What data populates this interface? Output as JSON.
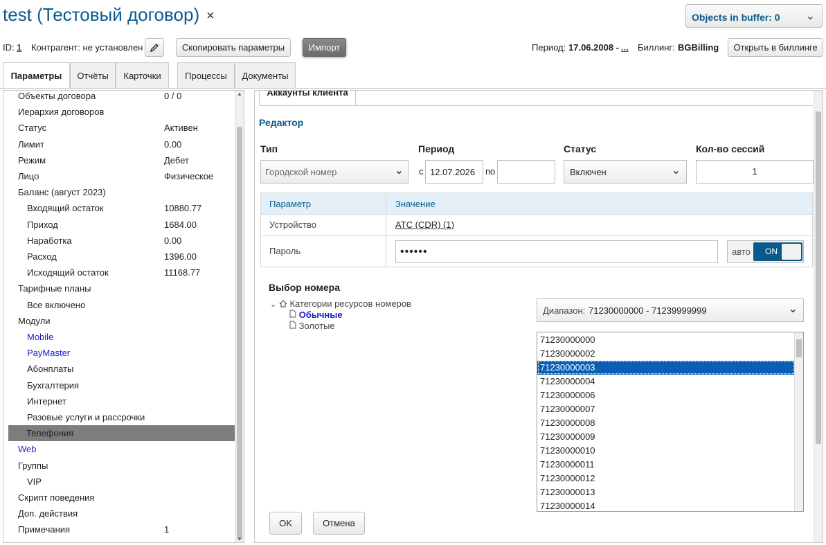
{
  "header": {
    "title": "test (Тестовый договор)",
    "close_icon": "×",
    "buffer_label": "Objects in buffer: 0",
    "id_label": "ID:",
    "id_value": "1",
    "contragent": "Контрагент: не установлен",
    "copy_params": "Скопировать параметры",
    "import": "Импорт",
    "period_label": "Период:",
    "period_value": "17.06.2008 -",
    "period_link": "...",
    "billing_label": "Биллинг:",
    "billing_value": "BGBilling",
    "open_billing": "Открыть в биллинге"
  },
  "tabs": [
    "Параметры",
    "Отчёты",
    "Карточки",
    "Процессы",
    "Документы"
  ],
  "left": {
    "rows": [
      {
        "label": "Объекты договора",
        "value": "0 / 0",
        "indent": 0
      },
      {
        "label": "Иерархия договоров",
        "value": "",
        "indent": 0
      },
      {
        "label": "Статус",
        "value": "Активен",
        "indent": 0
      },
      {
        "label": "Лимит",
        "value": "0.00",
        "indent": 0
      },
      {
        "label": "Режим",
        "value": "Дебет",
        "indent": 0
      },
      {
        "label": "Лицо",
        "value": "Физическое",
        "indent": 0
      },
      {
        "label": "Баланс (август 2023)",
        "value": "",
        "indent": 0
      },
      {
        "label": "Входящий остаток",
        "value": "10880.77",
        "indent": 1
      },
      {
        "label": "Приход",
        "value": "1684.00",
        "indent": 1
      },
      {
        "label": "Наработка",
        "value": "0.00",
        "indent": 1
      },
      {
        "label": "Расход",
        "value": "1396.00",
        "indent": 1
      },
      {
        "label": "Исходящий остаток",
        "value": "11168.77",
        "indent": 1
      },
      {
        "label": "Тарифные планы",
        "value": "",
        "indent": 0
      },
      {
        "label": "Все включено",
        "value": "",
        "indent": 1
      },
      {
        "label": "Модули",
        "value": "",
        "indent": 0
      },
      {
        "label": "Mobile",
        "value": "",
        "indent": 1,
        "blue": true
      },
      {
        "label": "PayMaster",
        "value": "",
        "indent": 1,
        "blue": true
      },
      {
        "label": "Абонплаты",
        "value": "",
        "indent": 1
      },
      {
        "label": "Бухгалтерия",
        "value": "",
        "indent": 1
      },
      {
        "label": "Интернет",
        "value": "",
        "indent": 1
      },
      {
        "label": "Разовые услуги и рассрочки",
        "value": "",
        "indent": 1
      },
      {
        "label": "Телефония",
        "value": "",
        "indent": 1,
        "selected": true
      },
      {
        "label": "Web",
        "value": "",
        "indent": 0,
        "blue": true
      },
      {
        "label": "Группы",
        "value": "",
        "indent": 0
      },
      {
        "label": "VIP",
        "value": "",
        "indent": 1
      },
      {
        "label": "Скрипт поведения",
        "value": "",
        "indent": 0
      },
      {
        "label": "Доп. действия",
        "value": "",
        "indent": 0
      },
      {
        "label": "Примечания",
        "value": "1",
        "indent": 0
      }
    ]
  },
  "right": {
    "subtab": "Аккаунты клиента",
    "editor_title": "Редактор",
    "type_label": "Тип",
    "type_value": "Городской номер",
    "period_label": "Период",
    "period_from_prefix": "с",
    "period_from": "12.07.2026",
    "period_to_prefix": "по",
    "period_to": "",
    "status_label": "Статус",
    "status_value": "Включен",
    "sessions_label": "Кол-во сессий",
    "sessions_value": "1",
    "table": {
      "col_param": "Параметр",
      "col_value": "Значение",
      "device_label": "Устройство",
      "device_value": "АТС (CDR) (1)",
      "password_label": "Пароль",
      "password_value": "••••••",
      "auto_label": "авто",
      "toggle_label": "ON"
    },
    "number_choice": "Выбор номера",
    "tree_root": "Категории ресурсов номеров",
    "tree_items": [
      "Обычные",
      "Золотые"
    ],
    "range_label": "Диапазон:",
    "range_value": "71230000000 - 71239999999",
    "numbers": [
      "71230000000",
      "71230000002",
      "71230000003",
      "71230000004",
      "71230000006",
      "71230000007",
      "71230000008",
      "71230000009",
      "71230000010",
      "71230000011",
      "71230000012",
      "71230000013",
      "71230000014"
    ],
    "selected_number": "71230000003",
    "ok": "OK",
    "cancel": "Отмена"
  }
}
